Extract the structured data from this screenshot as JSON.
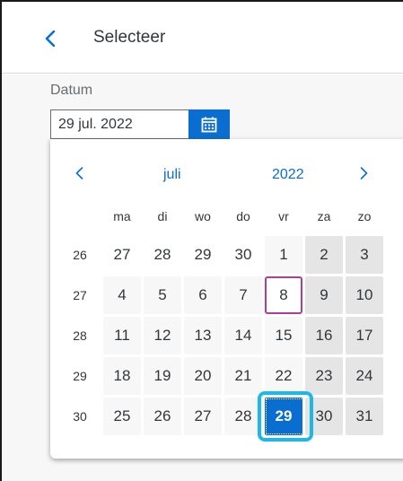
{
  "header": {
    "title": "Selecteer",
    "back_icon": "chevron-left-icon"
  },
  "field": {
    "label": "Datum",
    "value": "29 jul. 2022",
    "calendar_icon": "calendar-icon"
  },
  "calendar": {
    "month": "juli",
    "year": "2022",
    "prev_icon": "chevron-left-icon",
    "next_icon": "chevron-right-icon",
    "weekdays": [
      "ma",
      "di",
      "wo",
      "do",
      "vr",
      "za",
      "zo"
    ],
    "weeks": [
      {
        "number": "26",
        "days": [
          "27",
          "28",
          "29",
          "30",
          "1",
          "2",
          "3"
        ]
      },
      {
        "number": "27",
        "days": [
          "4",
          "5",
          "6",
          "7",
          "8",
          "9",
          "10"
        ]
      },
      {
        "number": "28",
        "days": [
          "11",
          "12",
          "13",
          "14",
          "15",
          "16",
          "17"
        ]
      },
      {
        "number": "29",
        "days": [
          "18",
          "19",
          "20",
          "21",
          "22",
          "23",
          "24"
        ]
      },
      {
        "number": "30",
        "days": [
          "25",
          "26",
          "27",
          "28",
          "29",
          "30",
          "31"
        ]
      }
    ],
    "today": "8",
    "selected": "29"
  },
  "colors": {
    "accent": "#0a6ed1",
    "today_border": "#a93e9b",
    "focus_ring": "#1fb6e8",
    "weekend_bg": "#e5e5e5",
    "workday_bg": "#f7f7f7"
  }
}
